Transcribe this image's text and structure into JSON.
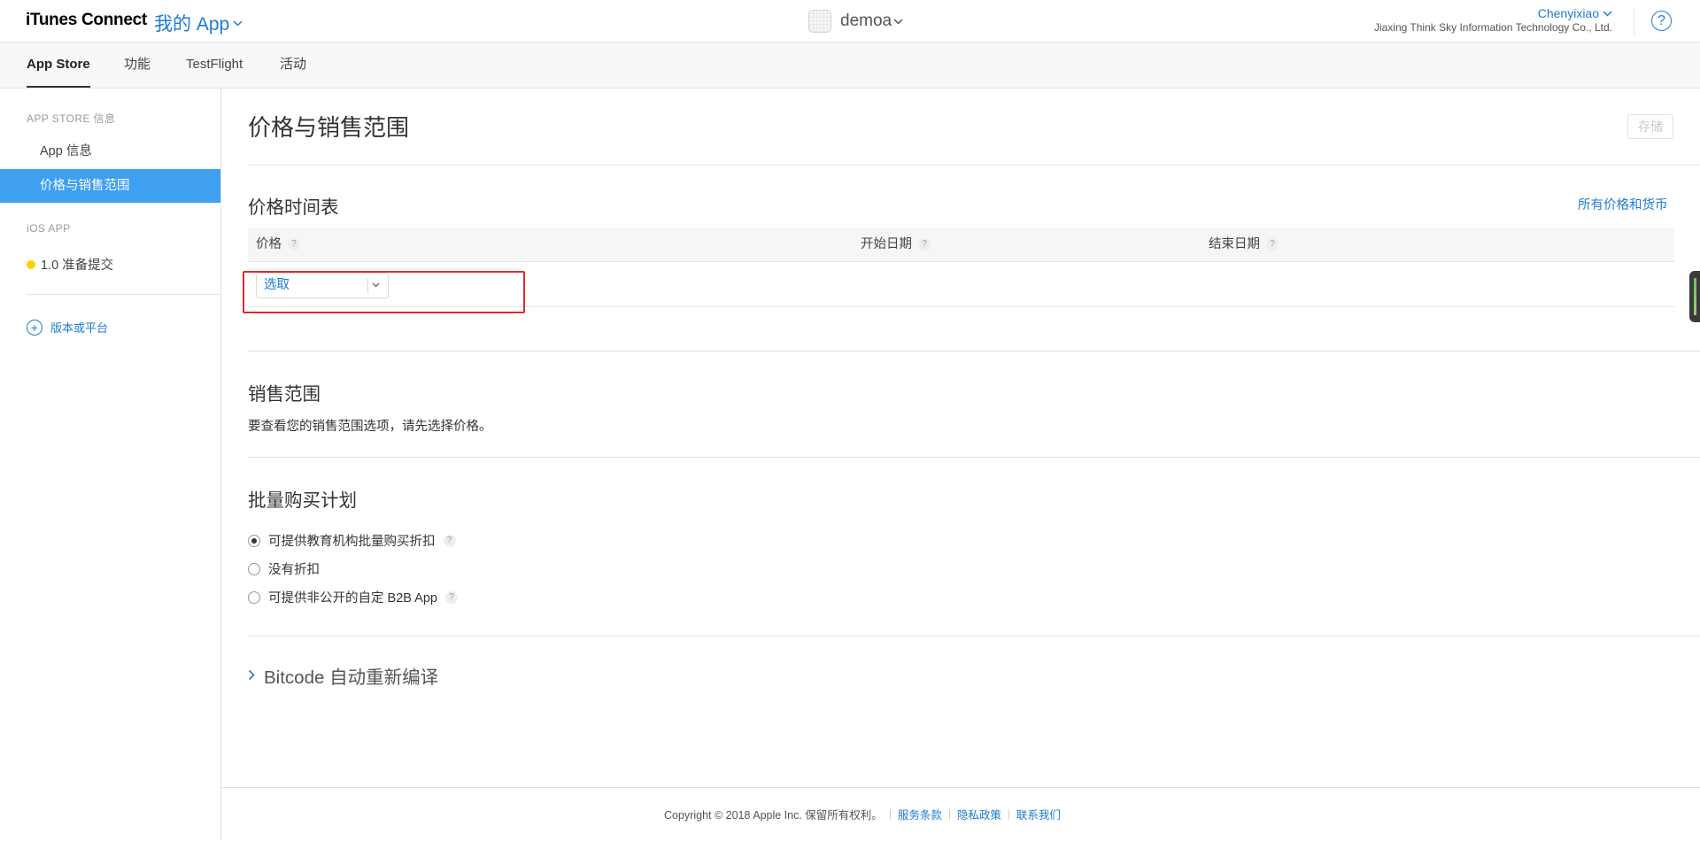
{
  "header": {
    "brand": "iTunes Connect",
    "my_app": "我的 App",
    "app_name": "demoa",
    "user_name": "Chenyixiao",
    "org_name": "Jiaxing Think Sky Information Technology Co., Ltd.",
    "help": "?"
  },
  "tabs": [
    {
      "label": "App Store",
      "active": true
    },
    {
      "label": "功能"
    },
    {
      "label": "TestFlight"
    },
    {
      "label": "活动"
    }
  ],
  "sidebar": {
    "section1": "APP STORE 信息",
    "items": [
      {
        "label": "App 信息"
      },
      {
        "label": "价格与销售范围",
        "selected": true
      }
    ],
    "section2": "iOS APP",
    "version": "1.0 准备提交",
    "add_version": "版本或平台"
  },
  "main": {
    "title": "价格与销售范围",
    "save": "存储",
    "schedule_title": "价格时间表",
    "all_prices_link": "所有价格和货币",
    "columns": [
      {
        "label": "价格",
        "help": "?"
      },
      {
        "label": "开始日期",
        "help": "?"
      },
      {
        "label": "结束日期",
        "help": "?"
      }
    ],
    "price_select": "选取",
    "availability_title": "销售范围",
    "availability_text": "要查看您的销售范围选项，请先选择价格。",
    "volume_title": "批量购买计划",
    "volume_options": [
      {
        "label": "可提供教育机构批量购买折扣",
        "checked": true,
        "help": "?"
      },
      {
        "label": "没有折扣",
        "checked": false
      },
      {
        "label": "可提供非公开的自定 B2B App",
        "checked": false,
        "help": "?"
      }
    ],
    "bitcode": "Bitcode 自动重新编译"
  },
  "footer": {
    "copyright": "Copyright © 2018 Apple Inc. 保留所有权利。",
    "links": [
      "服务条款",
      "隐私政策",
      "联系我们"
    ]
  },
  "colors": {
    "accent": "#1e7bd3",
    "sidebar_selected": "#3f9ff0",
    "status_dot": "#ffd200",
    "highlight_box": "#e32a2a"
  }
}
